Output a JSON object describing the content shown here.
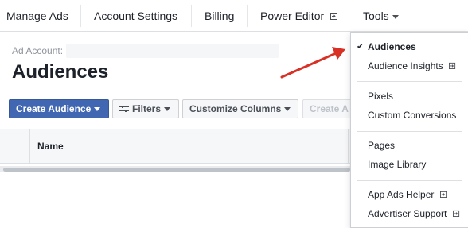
{
  "nav": {
    "manage_ads": "Manage Ads",
    "account_settings": "Account Settings",
    "billing": "Billing",
    "power_editor": "Power Editor",
    "tools": "Tools"
  },
  "header": {
    "account_label": "Ad Account:",
    "title": "Audiences"
  },
  "toolbar": {
    "create_audience": "Create Audience",
    "filters": "Filters",
    "customize_columns": "Customize Columns",
    "create_ad": "Create A"
  },
  "table": {
    "columns": [
      "Name"
    ]
  },
  "tools_menu": {
    "groups": [
      [
        {
          "label": "Audiences",
          "selected": true
        },
        {
          "label": "Audience Insights",
          "external": true
        }
      ],
      [
        {
          "label": "Pixels"
        },
        {
          "label": "Custom Conversions"
        }
      ],
      [
        {
          "label": "Pages"
        },
        {
          "label": "Image Library"
        }
      ],
      [
        {
          "label": "App Ads Helper",
          "external": true
        },
        {
          "label": "Advertiser Support",
          "external": true
        }
      ]
    ]
  },
  "colors": {
    "primary": "#4267b2",
    "arrow": "#d93025"
  }
}
